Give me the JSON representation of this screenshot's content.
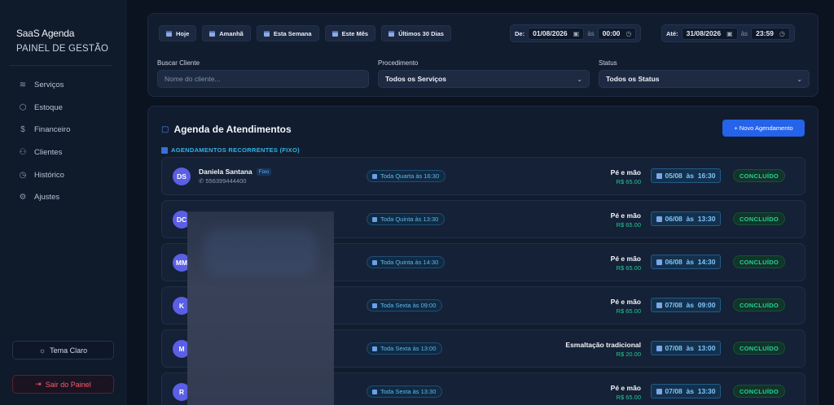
{
  "sidebar": {
    "brand_name": "SaaS Agenda",
    "brand_sub": "PAINEL DE GESTÃO",
    "items": [
      {
        "label": "Serviços",
        "icon": "layers-icon"
      },
      {
        "label": "Estoque",
        "icon": "box-icon"
      },
      {
        "label": "Financeiro",
        "icon": "dollar-icon"
      },
      {
        "label": "Clientes",
        "icon": "users-icon"
      },
      {
        "label": "Histórico",
        "icon": "clock-icon"
      },
      {
        "label": "Ajustes",
        "icon": "gear-icon"
      }
    ],
    "theme_label": "Tema Claro",
    "logout_label": "Sair do Painel"
  },
  "filters": {
    "quick": [
      "Hoje",
      "Amanhã",
      "Esta Semana",
      "Este Mês",
      "Últimos 30 Dias"
    ],
    "from_label": "De:",
    "from_date": "01/08/2026",
    "from_time": "00:00",
    "to_label": "Até:",
    "to_date": "31/08/2026",
    "to_time": "23:59",
    "at": "às",
    "client_label": "Buscar Cliente",
    "client_placeholder": "Nome do cliente...",
    "procedure_label": "Procedimento",
    "procedure_value": "Todos os Serviços",
    "status_label": "Status",
    "status_value": "Todos os Status"
  },
  "agenda": {
    "title": "Agenda de Atendimentos",
    "new_button": "+ Novo Agendamento",
    "recurring_title": "AGENDAMENTOS RECORRENTES (FIXO)",
    "rows": [
      {
        "initials": "DS",
        "name": "Daniela Santana",
        "tag": "Fixo",
        "phone": "✆ 556399444400",
        "recurrence": "Toda Quarta às 16:30",
        "procedure": "Pé e mão",
        "price": "R$ 65.00",
        "date": "05/08",
        "time": "16:30",
        "status": "CONCLUÍDO"
      },
      {
        "initials": "DC",
        "name": "",
        "tag": "",
        "phone": "",
        "recurrence": "Toda Quinta às 13:30",
        "procedure": "Pé e mão",
        "price": "R$ 65.00",
        "date": "06/08",
        "time": "13:30",
        "status": "CONCLUÍDO"
      },
      {
        "initials": "MM",
        "name": "",
        "tag": "",
        "phone": "",
        "recurrence": "Toda Quinta às 14:30",
        "procedure": "Pé e mão",
        "price": "R$ 65.00",
        "date": "06/08",
        "time": "14:30",
        "status": "CONCLUÍDO"
      },
      {
        "initials": "K",
        "name": "",
        "tag": "",
        "phone": "",
        "recurrence": "Toda Sexta às 09:00",
        "procedure": "Pé e mão",
        "price": "R$ 65.00",
        "date": "07/08",
        "time": "09:00",
        "status": "CONCLUÍDO"
      },
      {
        "initials": "M",
        "name": "",
        "tag": "",
        "phone": "",
        "recurrence": "Toda Sexta às 13:00",
        "procedure": "Esmaltação tradicional",
        "price": "R$ 20.00",
        "date": "07/08",
        "time": "13:00",
        "status": "CONCLUÍDO"
      },
      {
        "initials": "R",
        "name": "",
        "tag": "",
        "phone": "",
        "recurrence": "Toda Sexta às 13:30",
        "procedure": "Pé e mão",
        "price": "R$ 65.00",
        "date": "07/08",
        "time": "13:30",
        "status": "CONCLUÍDO"
      }
    ]
  },
  "colors": {
    "accent": "#2563eb",
    "success": "#25d19a",
    "info": "#33b3e8",
    "danger": "#ff5a6e"
  }
}
